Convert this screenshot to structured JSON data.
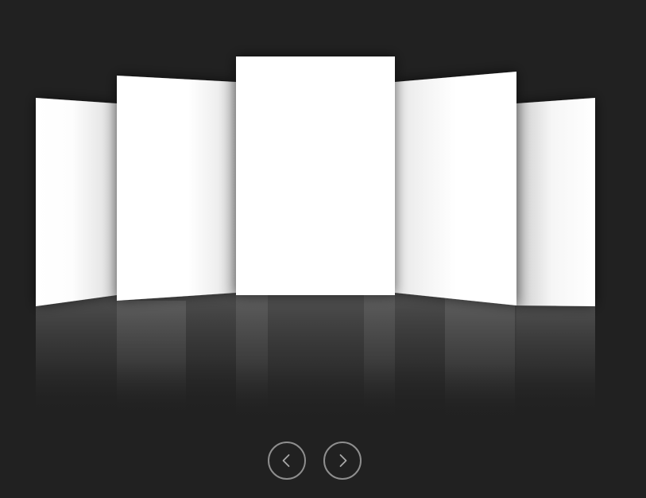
{
  "coverflow": {
    "slide_count": 5,
    "active_index": 2,
    "slide_color": "#ffffff",
    "background_color": "#212121",
    "reflection": true
  },
  "controls": {
    "prev_icon": "chevron-left-icon",
    "next_icon": "chevron-right-icon",
    "button_border_color": "#8e8e8e"
  }
}
